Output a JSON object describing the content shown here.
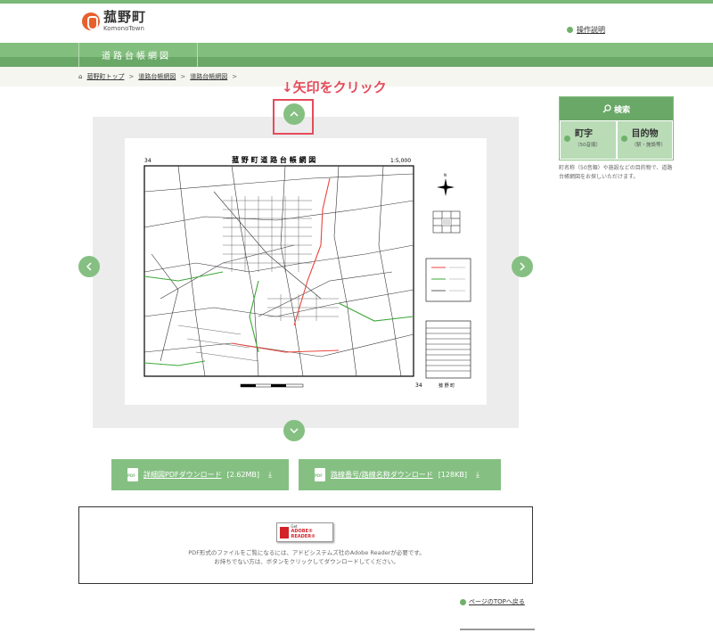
{
  "header": {
    "logo_jp": "菰野町",
    "logo_en": "KomonoTown",
    "help_link": "操作説明"
  },
  "band": {
    "title": "道路台帳網図"
  },
  "breadcrumbs": [
    "菰野町トップ",
    "道路台帳網図",
    "道路台帳網図"
  ],
  "annotation": "↓矢印をクリック",
  "map": {
    "title": "菰 野 町 道 路 台 帳 網 図",
    "scale": "1:5,000",
    "sheet_top_left": "34",
    "sheet_bottom_right": "34",
    "bottom_label": "菰 野 町",
    "nav_up": "^",
    "nav_down": "v",
    "nav_left": "‹",
    "nav_right": "›",
    "road_colors": {
      "national": "#e8463c",
      "prefectural": "#3da838",
      "town": "#333333"
    }
  },
  "downloads": [
    {
      "label": "詳細図PDFダウンロード",
      "size": "[2.62MB]"
    },
    {
      "label": "路線番号/路線名称ダウンロード",
      "size": "[128KB]"
    }
  ],
  "adobe": {
    "badge_small": "Get",
    "badge_brand": "ADOBE® READER®",
    "text_line1": "PDF形式のファイルをご覧になるには、アドビシステムズ社のAdobe Readerが必要です。",
    "text_line2": "お持ちでない方は、ボタンをクリックしてダウンロードしてください。"
  },
  "page_top": "ページのTOPへ戻る",
  "sidebar": {
    "search_title": "検索",
    "search_icon": "magnifier-icon",
    "buttons": [
      {
        "label": "町字",
        "sub": "（50音順）"
      },
      {
        "label": "目的物",
        "sub": "（駅・施設等）"
      }
    ],
    "note": "町名称（50音順）や施設などの目的物で、道路台帳網図をお探しいただけます。"
  }
}
